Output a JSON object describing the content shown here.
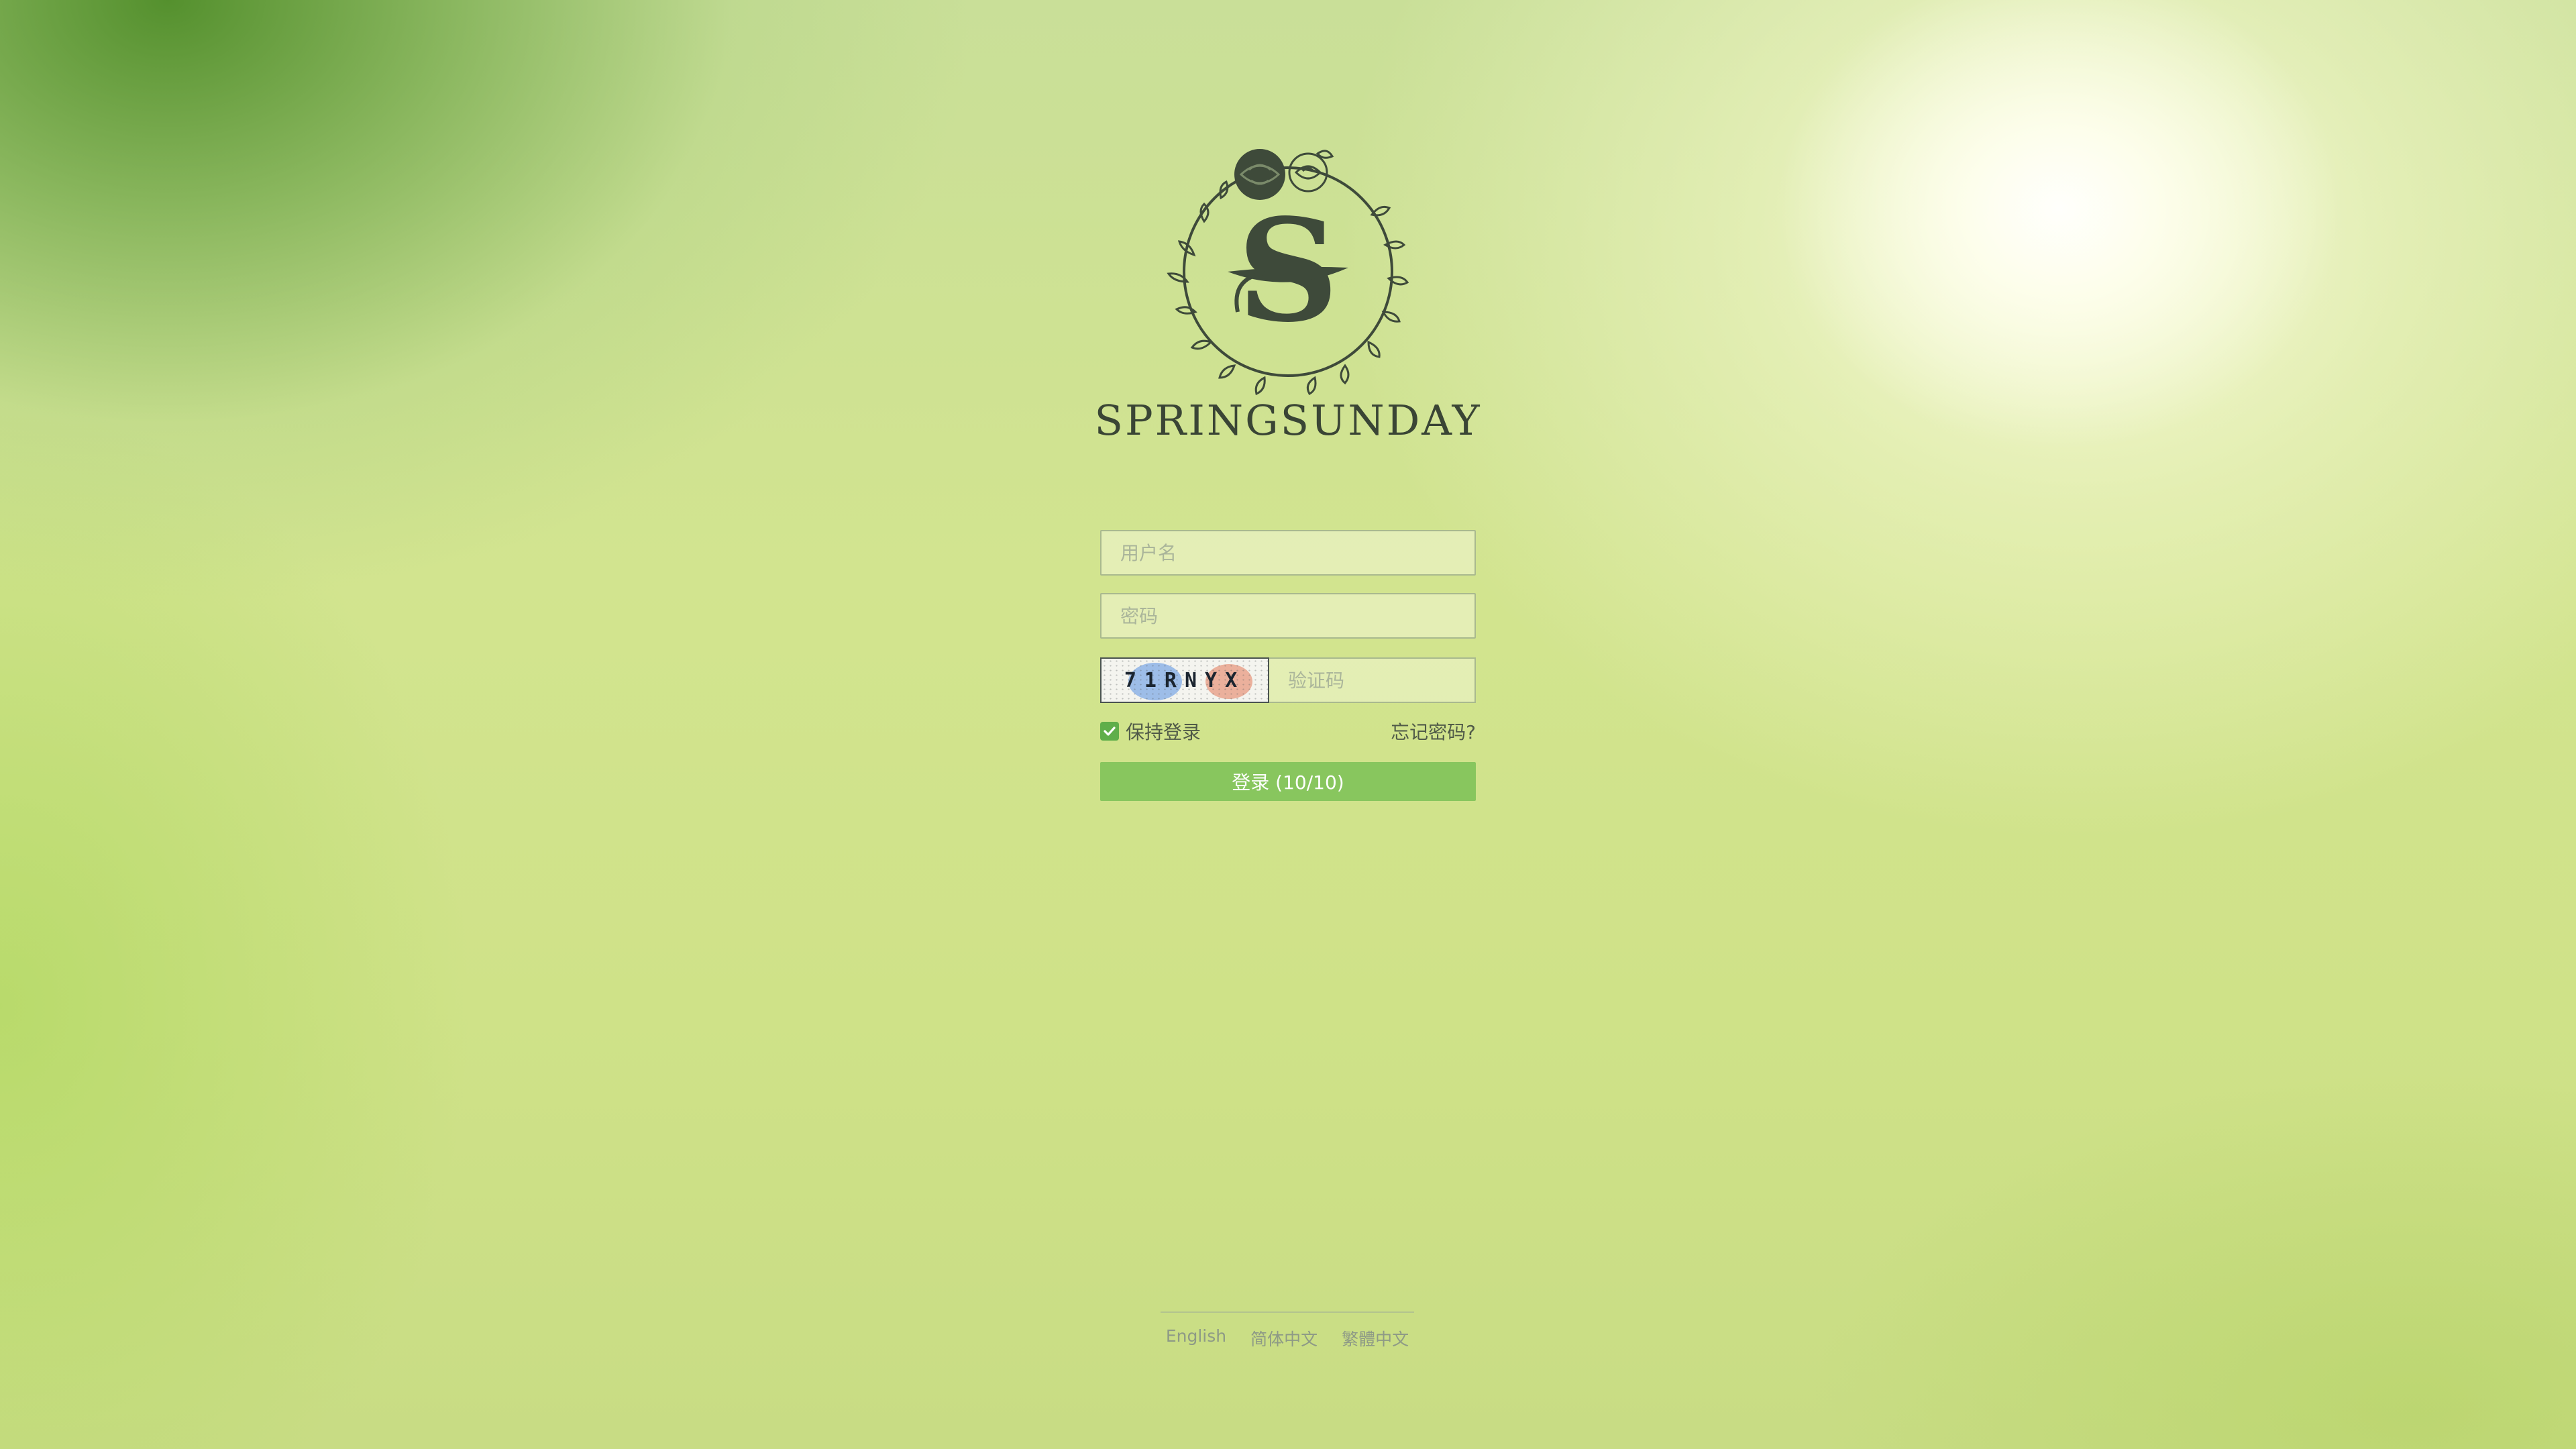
{
  "brand": {
    "name": "SPRINGSUNDAY",
    "logo_icon": "rose-wreath-s-logo"
  },
  "login_form": {
    "username_placeholder": "用户名",
    "password_placeholder": "密码",
    "captcha_text": "71RNYX",
    "captcha_placeholder": "验证码",
    "remember_label": "保持登录",
    "remember_checked": true,
    "forgot_password": "忘记密码?",
    "login_button": "登录 (10/10)"
  },
  "footer": {
    "languages": [
      "English",
      "简体中文",
      "繁體中文"
    ]
  },
  "colors": {
    "button": "#88c65e",
    "checkbox": "#5fae4a",
    "brand_text": "#3a4535"
  }
}
